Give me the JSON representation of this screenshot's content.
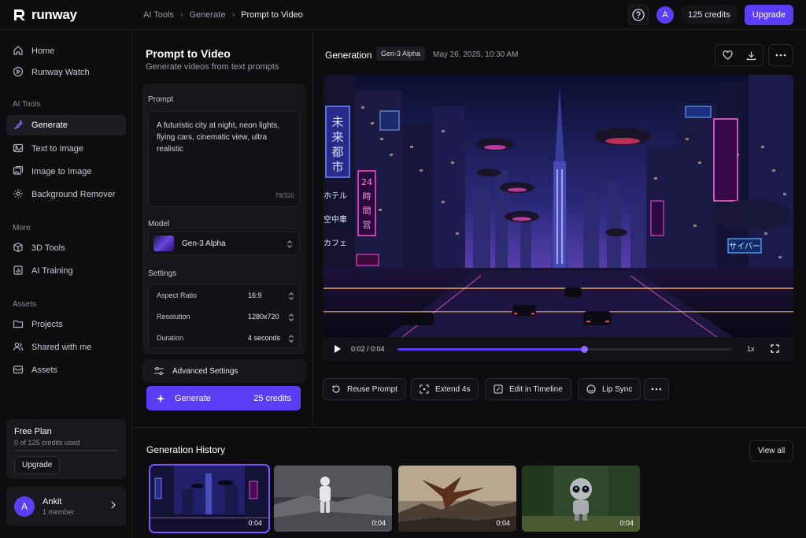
{
  "brand": {
    "name": "runway"
  },
  "breadcrumb": [
    "AI Tools",
    "Generate",
    "Prompt to Video"
  ],
  "topbar": {
    "avatar_initial": "A",
    "credits": "125 credits",
    "upgrade": "Upgrade"
  },
  "sidebar": {
    "items_top": [
      {
        "label": "Home",
        "icon": "home-icon"
      },
      {
        "label": "Runway Watch",
        "icon": "play-circle-icon"
      }
    ],
    "section_ai": "AI Tools",
    "items_ai": [
      {
        "label": "Generate",
        "icon": "sparkle-brush-icon",
        "active": true
      },
      {
        "label": "Text to Image",
        "icon": "image-icon"
      },
      {
        "label": "Image to Image",
        "icon": "images-icon"
      },
      {
        "label": "Background Remover",
        "icon": "gear-icon"
      }
    ],
    "section_more": "More",
    "items_more": [
      {
        "label": "3D Tools",
        "icon": "cube-icon"
      },
      {
        "label": "AI Training",
        "icon": "training-icon"
      }
    ],
    "section_assets": "Assets",
    "items_assets": [
      {
        "label": "Projects",
        "icon": "folder-icon"
      },
      {
        "label": "Shared with me",
        "icon": "users-icon"
      },
      {
        "label": "Assets",
        "icon": "archive-icon"
      }
    ],
    "plan": {
      "title": "Free Plan",
      "usage": "0 of 125 credits used",
      "used_fraction": 0,
      "upgrade": "Upgrade"
    },
    "user": {
      "initial": "A",
      "name": "Ankit",
      "members": "1 member"
    }
  },
  "left_panel": {
    "title": "Prompt to Video",
    "subtitle": "Generate videos from text prompts",
    "prompt_label": "Prompt",
    "prompt_text": "A futuristic city at night, neon lights, flying cars, cinematic view, ultra realistic",
    "char_count": "78/320",
    "model_label": "Model",
    "model_value": "Gen-3 Alpha",
    "settings_label": "Settings",
    "settings": [
      {
        "label": "Aspect Ratio",
        "value": "16:9"
      },
      {
        "label": "Resolution",
        "value": "1280x720"
      },
      {
        "label": "Duration",
        "value": "4 seconds"
      }
    ],
    "advanced": "Advanced Settings",
    "generate": "Generate",
    "generate_credits": "25 credits"
  },
  "main": {
    "title": "Generation",
    "model_tag": "Gen-3 Alpha",
    "date": "May 26, 2025, 10:30 AM",
    "player": {
      "time": "0:02 / 0:04",
      "progress": 0.56,
      "speed": "1x"
    },
    "actions": [
      {
        "label": "Reuse Prompt",
        "icon": "reuse-icon"
      },
      {
        "label": "Extend 4s",
        "icon": "extend-icon"
      },
      {
        "label": "Edit in Timeline",
        "icon": "edit-icon"
      },
      {
        "label": "Lip Sync",
        "icon": "lip-sync-icon"
      }
    ]
  },
  "history": {
    "title": "Generation History",
    "view_all": "View all",
    "items": [
      {
        "time": "0:04",
        "selected": true
      },
      {
        "time": "0:04"
      },
      {
        "time": "0:04"
      },
      {
        "time": "0:04"
      }
    ]
  },
  "colors": {
    "accent": "#5b3df5",
    "accent_light": "#8b6cff",
    "bg": "#0d0d10"
  }
}
